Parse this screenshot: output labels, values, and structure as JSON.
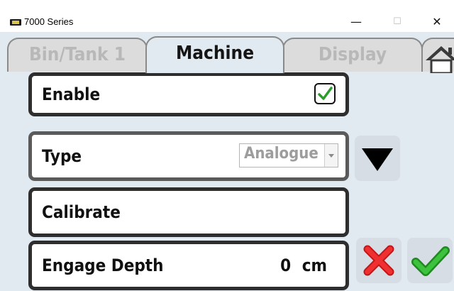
{
  "window": {
    "title": "7000 Series",
    "minimize_glyph": "—",
    "maximize_glyph": "☐",
    "close_glyph": "✕"
  },
  "tabs": [
    {
      "label": "Bin/Tank 1",
      "active": false
    },
    {
      "label": "Machine",
      "active": true
    },
    {
      "label": "Display",
      "active": false
    }
  ],
  "icons": {
    "app": "monitor-icon",
    "home": "home-icon",
    "dropdown": "triangle-down-icon",
    "cancel": "red-x-icon",
    "confirm": "green-check-icon"
  },
  "settings": {
    "enable": {
      "label": "Enable",
      "checked": true
    },
    "type": {
      "label": "Type",
      "value": "Analogue"
    },
    "calibrate": {
      "label": "Calibrate"
    },
    "engage_depth": {
      "label": "Engage Depth",
      "value": "0",
      "unit": "cm"
    }
  },
  "colors": {
    "background": "#e1e9f1",
    "checkmark": "#2a9d2a",
    "cancel": "#e02020",
    "confirm": "#2faa2f"
  }
}
